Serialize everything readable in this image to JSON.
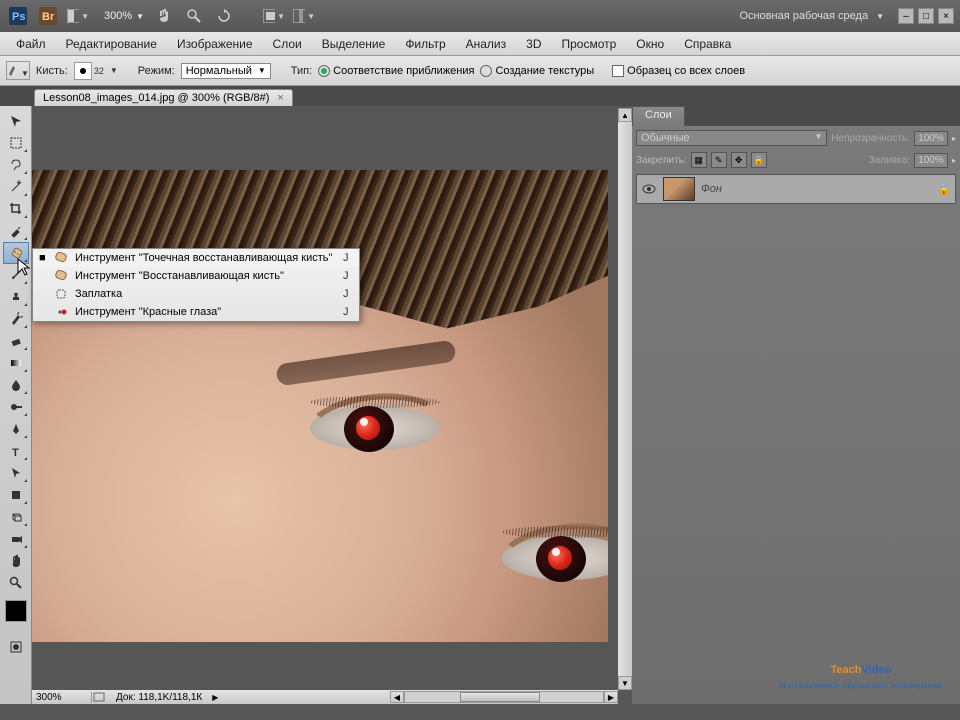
{
  "top": {
    "zoom": "300%",
    "workspace": "Основная рабочая среда"
  },
  "menu": [
    "Файл",
    "Редактирование",
    "Изображение",
    "Слои",
    "Выделение",
    "Фильтр",
    "Анализ",
    "3D",
    "Просмотр",
    "Окно",
    "Справка"
  ],
  "options": {
    "brush_label": "Кисть:",
    "brush_size": "32",
    "mode_label": "Режим:",
    "mode_value": "Нормальный",
    "type_label": "Тип:",
    "radio1": "Соответствие приближения",
    "radio2": "Создание текстуры",
    "check1": "Образец со всех слоев"
  },
  "doc_tab": {
    "title": "Lesson08_images_014.jpg @ 300% (RGB/8#)",
    "close": "×"
  },
  "flyout": [
    {
      "selected": true,
      "label": "Инструмент \"Точечная восстанавливающая кисть\"",
      "key": "J",
      "icon": "spot-heal"
    },
    {
      "selected": false,
      "label": "Инструмент \"Восстанавливающая кисть\"",
      "key": "J",
      "icon": "heal"
    },
    {
      "selected": false,
      "label": "Заплатка",
      "key": "J",
      "icon": "patch"
    },
    {
      "selected": false,
      "label": "Инструмент \"Красные глаза\"",
      "key": "J",
      "icon": "redeye"
    }
  ],
  "layers": {
    "tab": "Слои",
    "blend": "Обычные",
    "opacity_label": "Непрозрачность:",
    "opacity_value": "100%",
    "lock_label": "Закрепить:",
    "fill_label": "Заливка:",
    "fill_value": "100%",
    "layer_name": "Фон"
  },
  "status": {
    "zoom": "300%",
    "doc": "Док: 118,1K/118,1К"
  },
  "watermark": {
    "t1a": "Teach",
    "t1b": "Video",
    "t2": "Интерактивное обучающее телевидение"
  }
}
